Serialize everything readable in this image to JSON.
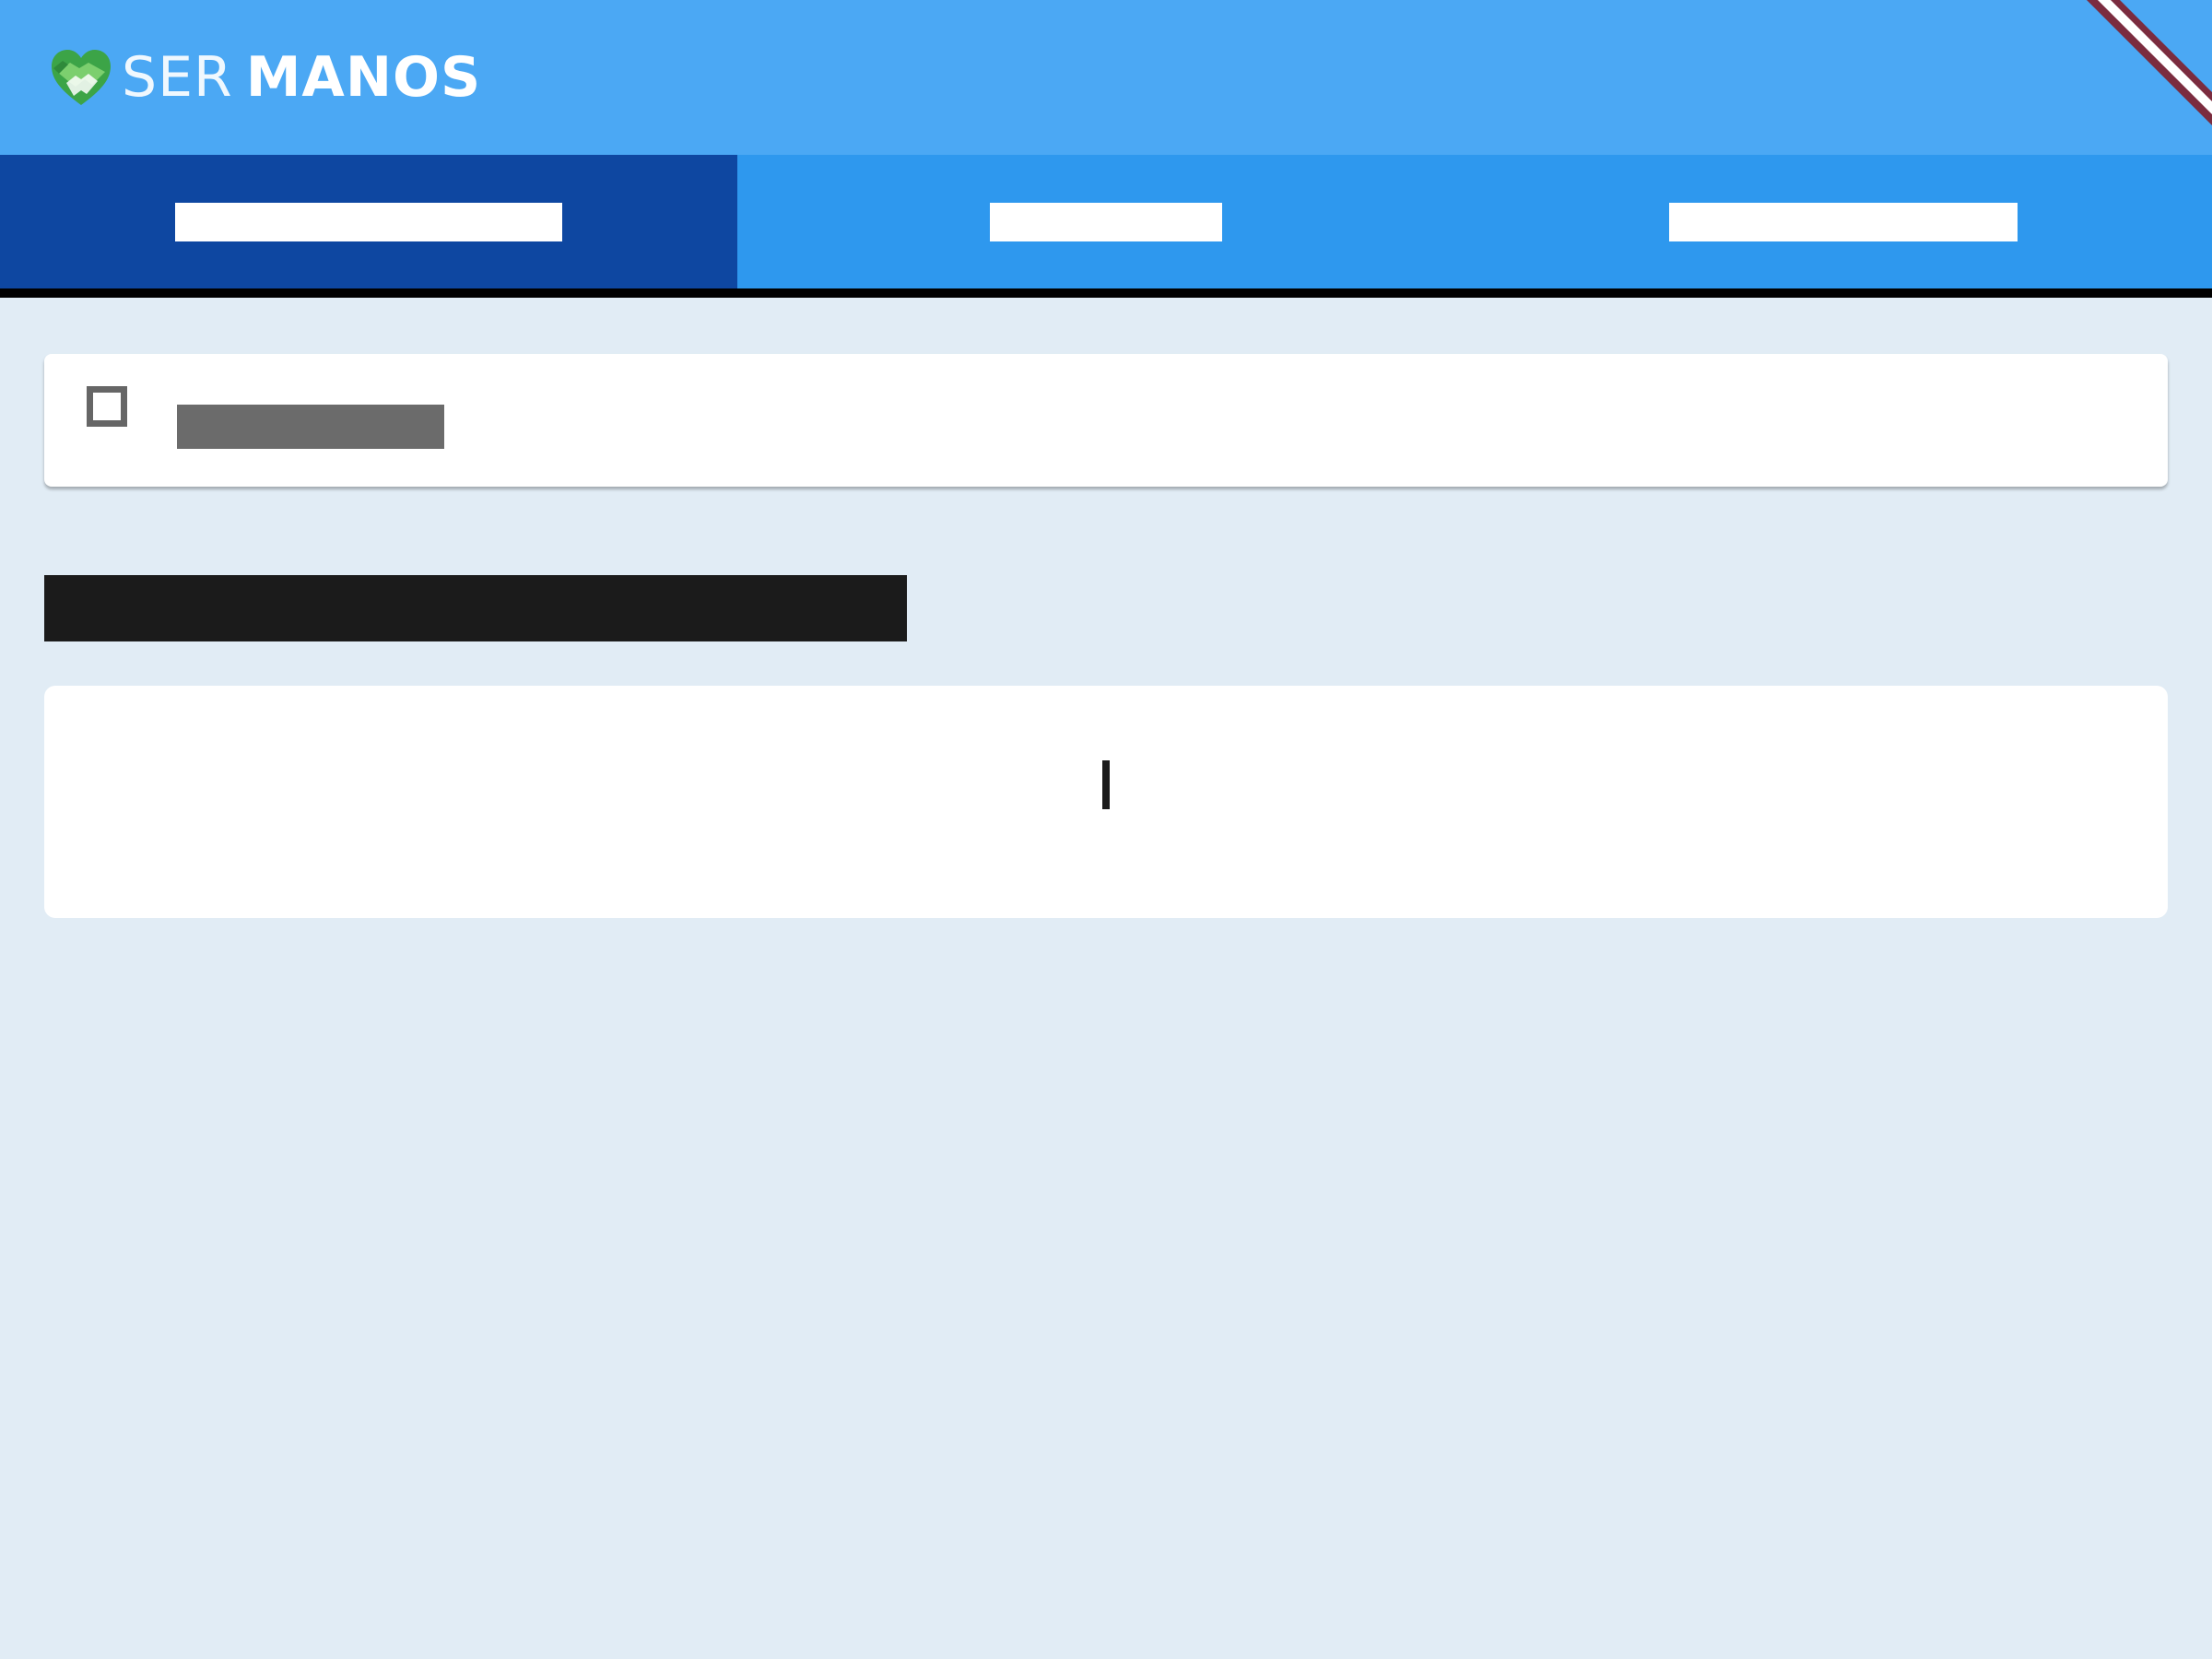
{
  "app": {
    "brand_light": "SER",
    "brand_bold": "MANOS",
    "colors": {
      "header": "#4BA8F4",
      "tab_bar": "#2E98EE",
      "active_tab": "#0E47A1",
      "background": "#E1ECF5",
      "logo_green": "#3CA447",
      "ribbon": "#7B2C3F"
    }
  },
  "nav": {
    "tabs": [
      {
        "label": "",
        "active": true
      },
      {
        "label": "",
        "active": false
      },
      {
        "label": "",
        "active": false
      }
    ]
  },
  "filter": {
    "checkbox_checked": false,
    "label": ""
  },
  "section": {
    "title": ""
  },
  "message": {
    "text": ""
  },
  "icons": {
    "logo": "heart-handshake-icon",
    "checkbox": "checkbox-outline-icon",
    "ribbon": "corner-ribbon-icon"
  }
}
